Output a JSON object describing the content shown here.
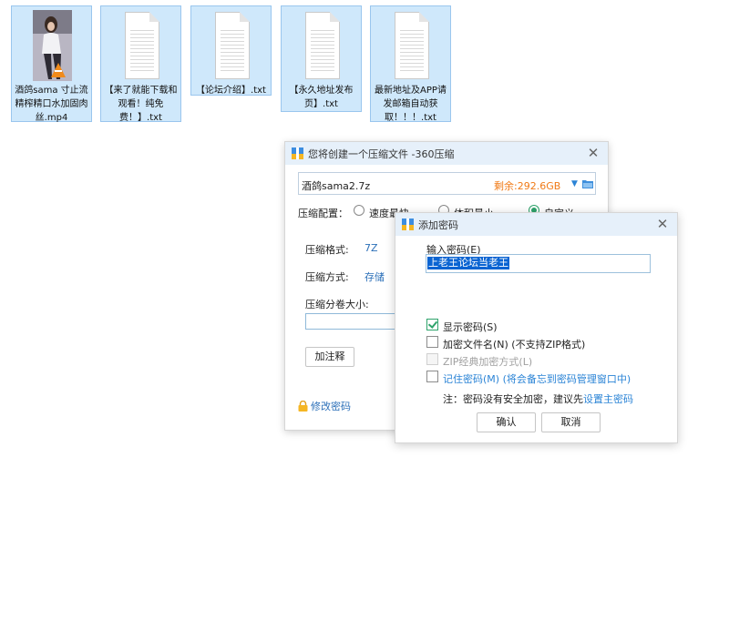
{
  "files": [
    {
      "type": "video",
      "icon": "video-thumbnail-icon",
      "label": "酒鸽sama 寸止流精榨精口水加固肉丝.mp4"
    },
    {
      "type": "text",
      "icon": "text-file-icon",
      "label": "【来了就能下载和观看！纯免费！】.txt"
    },
    {
      "type": "text",
      "icon": "text-file-icon",
      "label": "【论坛介绍】.txt"
    },
    {
      "type": "text",
      "icon": "text-file-icon",
      "label": "【永久地址发布页】.txt"
    },
    {
      "type": "text",
      "icon": "text-file-icon",
      "label": "最新地址及APP请发邮箱自动获取！！！.txt"
    }
  ],
  "compress_window": {
    "title": "您将创建一个压缩文件 -360压缩",
    "filename": "酒鸽sama2.7z",
    "remaining": "剩余:292.6GB",
    "config_label": "压缩配置：",
    "options": [
      "速度最快",
      "体积最小",
      "自定义"
    ],
    "selected_option": "自定义",
    "format_label": "压缩格式:",
    "format_value": "7Z",
    "method_label": "压缩方式:",
    "method_value": "存储",
    "split_label": "压缩分卷大小:",
    "comment_button": "加注释",
    "change_password": "修改密码"
  },
  "password_window": {
    "title": "添加密码",
    "input_label": "输入密码(E)",
    "password_value": "上老王论坛当老王",
    "show_password": "显示密码(S)",
    "encrypt_names": "加密文件名(N) (不支持ZIP格式)",
    "zip_classic": "ZIP经典加密方式(L)",
    "remember": "记住密码(M) (将会备忘到密码管理窗口中)",
    "note_prefix": "注：密码没有安全加密，建议先",
    "note_link": "设置主密码",
    "ok_button": "确认",
    "cancel_button": "取消"
  },
  "colors": {
    "accent_blue": "#2b84d6",
    "remaining_orange": "#f07a16",
    "check_green": "#2ea36b",
    "selection_blue": "#0a64d2"
  }
}
